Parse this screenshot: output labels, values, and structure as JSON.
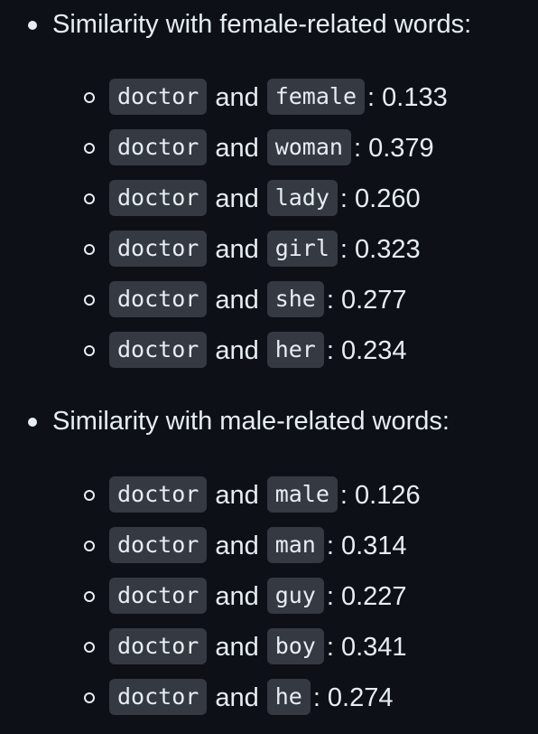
{
  "sections": [
    {
      "heading": "Similarity with female-related words:",
      "items": [
        {
          "a": "doctor",
          "conj": "and",
          "b": "female",
          "score": ": 0.133"
        },
        {
          "a": "doctor",
          "conj": "and",
          "b": "woman",
          "score": ": 0.379"
        },
        {
          "a": "doctor",
          "conj": "and",
          "b": "lady",
          "score": ": 0.260"
        },
        {
          "a": "doctor",
          "conj": "and",
          "b": "girl",
          "score": ": 0.323"
        },
        {
          "a": "doctor",
          "conj": "and",
          "b": "she",
          "score": ": 0.277"
        },
        {
          "a": "doctor",
          "conj": "and",
          "b": "her",
          "score": ": 0.234"
        }
      ]
    },
    {
      "heading": "Similarity with male-related words:",
      "items": [
        {
          "a": "doctor",
          "conj": "and",
          "b": "male",
          "score": ": 0.126"
        },
        {
          "a": "doctor",
          "conj": "and",
          "b": "man",
          "score": ": 0.314"
        },
        {
          "a": "doctor",
          "conj": "and",
          "b": "guy",
          "score": ": 0.227"
        },
        {
          "a": "doctor",
          "conj": "and",
          "b": "boy",
          "score": ": 0.341"
        },
        {
          "a": "doctor",
          "conj": "and",
          "b": "he",
          "score": ": 0.274"
        }
      ]
    }
  ]
}
